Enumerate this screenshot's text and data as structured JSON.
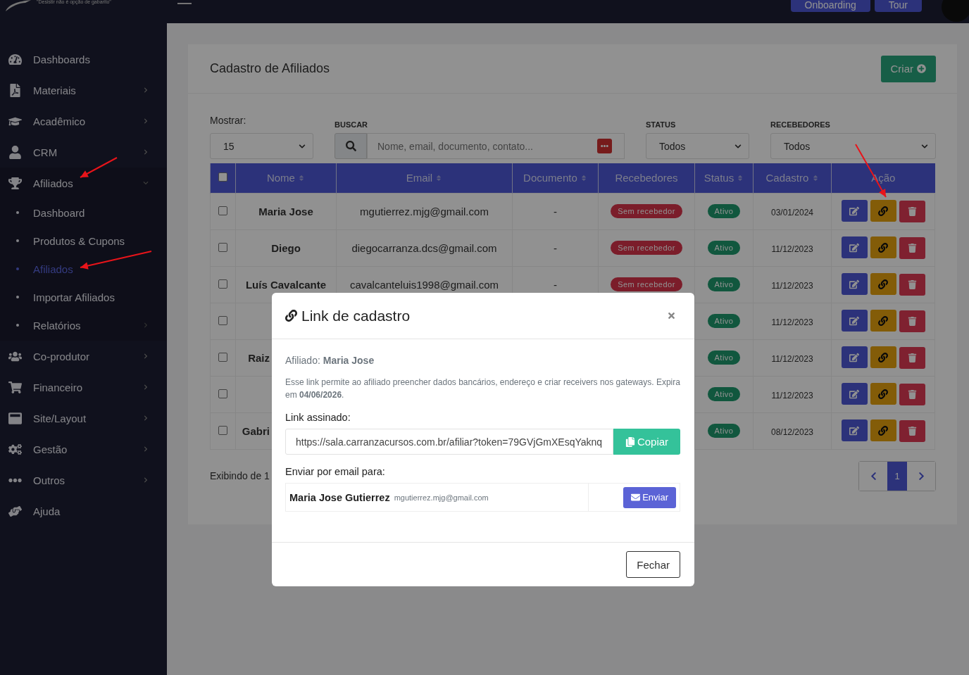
{
  "header": {
    "tagline": "\"Desistir não é opção de gabarito\"",
    "buttons": [
      "Onboarding",
      "Tour"
    ]
  },
  "sidebar": {
    "items": [
      {
        "label": "Dashboards",
        "has_submenu": false
      },
      {
        "label": "Materiais",
        "has_submenu": true
      },
      {
        "label": "Acadêmico",
        "has_submenu": true
      },
      {
        "label": "CRM",
        "has_submenu": true
      },
      {
        "label": "Afiliados",
        "has_submenu": true,
        "expanded": true,
        "children": [
          {
            "label": "Dashboard",
            "selected": false,
            "has_submenu": false
          },
          {
            "label": "Produtos & Cupons",
            "selected": false,
            "has_submenu": false
          },
          {
            "label": "Afiliados",
            "selected": true,
            "has_submenu": false
          },
          {
            "label": "Importar Afiliados",
            "selected": false,
            "has_submenu": false
          },
          {
            "label": "Relatórios",
            "selected": false,
            "has_submenu": true
          }
        ]
      },
      {
        "label": "Co-produtor",
        "has_submenu": true
      },
      {
        "label": "Financeiro",
        "has_submenu": true
      },
      {
        "label": "Site/Layout",
        "has_submenu": true
      },
      {
        "label": "Gestão",
        "has_submenu": true
      },
      {
        "label": "Outros",
        "has_submenu": true
      },
      {
        "label": "Ajuda",
        "has_submenu": false
      }
    ]
  },
  "page": {
    "title": "Cadastro de Afiliados",
    "create_button": "Criar"
  },
  "filters": {
    "show_label": "Mostrar:",
    "show_value": "15",
    "search_label": "BUSCAR",
    "search_placeholder": "Nome, email, documento, contato...",
    "status_label": "STATUS",
    "status_value": "Todos",
    "receivers_label": "RECEBEDORES",
    "receivers_value": "Todos"
  },
  "table": {
    "all_checked": false,
    "columns": [
      {
        "label": "Nome",
        "sortable": true
      },
      {
        "label": "Email",
        "sortable": true
      },
      {
        "label": "Documento",
        "sortable": true
      },
      {
        "label": "Recebedores",
        "sortable": false
      },
      {
        "label": "Status",
        "sortable": true
      },
      {
        "label": "Cadastro",
        "sortable": true
      },
      {
        "label": "Ação",
        "sortable": false
      }
    ],
    "rows": [
      {
        "checked": false,
        "name": "Maria Jose",
        "email": "mgutierrez.mjg@gmail.com",
        "document": "-",
        "receivers": "Sem recebedor",
        "status": "Ativo",
        "date": "03/01/2024"
      },
      {
        "checked": false,
        "name": "Diego",
        "email": "diegocarranza.dcs@gmail.com",
        "document": "-",
        "receivers": "Sem recebedor",
        "status": "Ativo",
        "date": "11/12/2023"
      },
      {
        "checked": false,
        "name": "Luís Cavalcante",
        "email": "cavalcanteluis1998@gmail.com",
        "document": "-",
        "receivers": "Sem recebedor",
        "status": "Ativo",
        "date": "11/12/2023"
      },
      {
        "checked": false,
        "status": "Ativo",
        "date": "11/12/2023"
      },
      {
        "checked": false,
        "name": "Raiz",
        "name_cut": true,
        "status": "Ativo",
        "date": "11/12/2023"
      },
      {
        "checked": false,
        "status": "Ativo",
        "date": "11/12/2023"
      },
      {
        "checked": false,
        "name": "Gabri",
        "name_cut": true,
        "status": "Ativo",
        "date": "08/12/2023"
      }
    ]
  },
  "footer": {
    "summary": "Exibindo de 1",
    "pages": [
      {
        "label": "1",
        "selected": true
      }
    ]
  },
  "modal": {
    "title": "Link de cadastro",
    "affiliate_label": "Afiliado:",
    "affiliate_name": "Maria Jose",
    "description": "Esse link permite ao afiliado preencher dados bancários, endereço e criar receivers nos gateways. Expira em **04/06/2026**.",
    "link_label": "Link assinado:",
    "link_value": "https://sala.carranzacursos.com.br/afiliar?token=79GVjGmXEsqYaknq",
    "copy_button": "Copiar",
    "email_label": "Enviar por email para:",
    "recipient_name": "Maria Jose Gutierrez",
    "recipient_email": "mgutierrez.mjg@gmail.com",
    "send_button": "Enviar",
    "close_button": "Fechar"
  }
}
